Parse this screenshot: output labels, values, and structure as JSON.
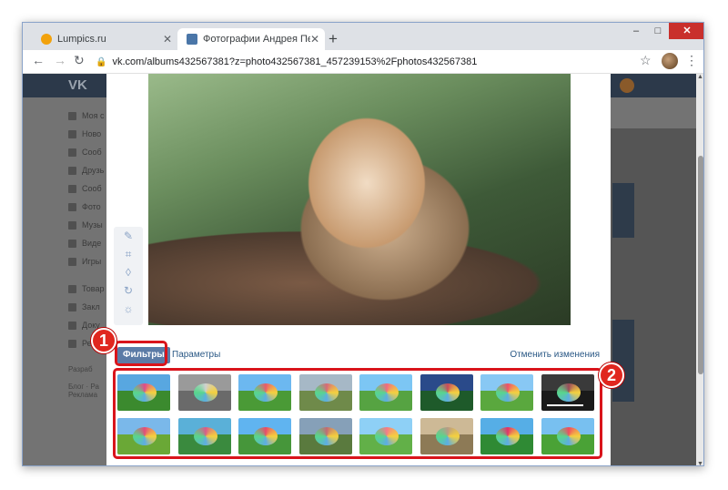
{
  "browser": {
    "tabs": [
      {
        "title": "Lumpics.ru",
        "active": false
      },
      {
        "title": "Фотографии Андрея Петрова",
        "active": true
      }
    ],
    "new_tab_label": "+",
    "address": "vk.com/albums432567381?z=photo432567381_457239153%2Fphotos432567381",
    "window_controls": [
      "–",
      "□",
      "✕"
    ]
  },
  "vk": {
    "logo": "VK",
    "sidebar_items": [
      "Моя с",
      "Ново",
      "Сооб",
      "Друзь",
      "Сооб",
      "Фото",
      "Музы",
      "Виде",
      "Игры",
      "Товар",
      "Закл",
      "Доку",
      "Рекл"
    ],
    "footer_lines": [
      "Разраб",
      "Блог · Ра",
      "Реклама"
    ]
  },
  "editor": {
    "tab_filters": "Фильтры",
    "tab_params": "Параметры",
    "revert": "Отменить изменения",
    "tools": [
      "pencil-icon",
      "crop-icon",
      "blur-icon",
      "rotate-icon",
      "brightness-icon"
    ]
  },
  "filters": [
    {
      "sky": "#58a7e0",
      "grass": "#3b8a2e",
      "umb": "#e04a8a"
    },
    {
      "sky": "#9a9a9a",
      "grass": "#6a6a6a",
      "umb": "#d0d0d0"
    },
    {
      "sky": "#6cb8f0",
      "grass": "#4a9a36",
      "umb": "#ea5a6a"
    },
    {
      "sky": "#a6b8c6",
      "grass": "#6f8a4a",
      "umb": "#d76a78"
    },
    {
      "sky": "#7cc6f4",
      "grass": "#56a342",
      "umb": "#f06a80"
    },
    {
      "sky": "#2a4a8a",
      "grass": "#1e5a2a",
      "umb": "#c84a5a"
    },
    {
      "sky": "#88c8f4",
      "grass": "#5aa83e",
      "umb": "#f0506a"
    },
    {
      "sky": "#3a3a3a",
      "grass": "#1a1a1a",
      "umb": "#9a4a5a"
    },
    {
      "sky": "#7ab8ea",
      "grass": "#6aa836",
      "umb": "#e44a7a"
    },
    {
      "sky": "#5ab0d8",
      "grass": "#3a8a3e",
      "umb": "#d85a8a"
    },
    {
      "sky": "#60b4f0",
      "grass": "#46963a",
      "umb": "#e84a6a"
    },
    {
      "sky": "#86a0b8",
      "grass": "#5a7a3e",
      "umb": "#c06a74"
    },
    {
      "sky": "#8ed0f6",
      "grass": "#62b048",
      "umb": "#f47a8a"
    },
    {
      "sky": "#cdb996",
      "grass": "#8d7a56",
      "umb": "#b89a86"
    },
    {
      "sky": "#56aee6",
      "grass": "#2f8a34",
      "umb": "#e2306a"
    },
    {
      "sky": "#78c0f0",
      "grass": "#4aa236",
      "umb": "#f04a60"
    }
  ],
  "annotations": [
    "1",
    "2"
  ]
}
